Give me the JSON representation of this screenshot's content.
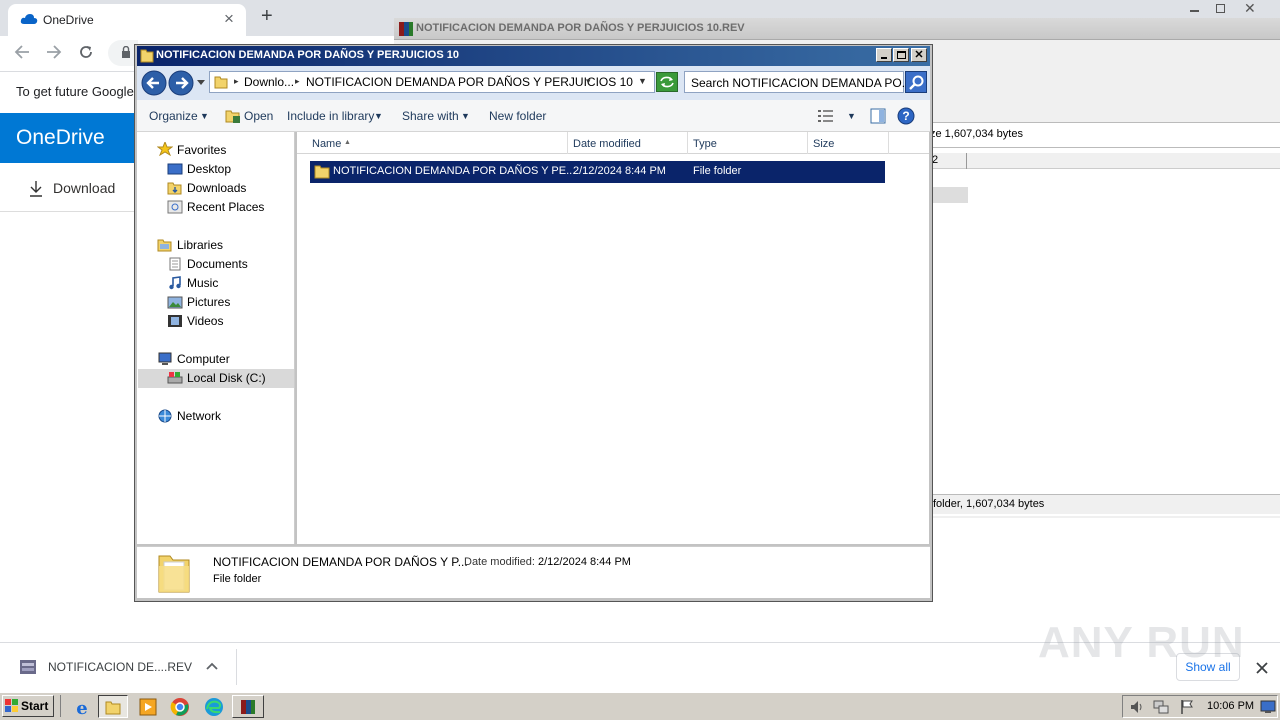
{
  "chrome": {
    "tab_title": "OneDrive",
    "new_tab_symbol": "+",
    "close_symbol": "×",
    "infobar_text": "To get future Google",
    "onedrive_brand": "OneDrive",
    "download_label": "Download",
    "download_bar_file": "NOTIFICACION DE....REV",
    "show_all_label": "Show all",
    "icons": [
      "onedrive-cloud-icon",
      "back-icon",
      "forward-icon",
      "reload-icon",
      "lock-icon",
      "download-arrow-icon",
      "file-icon",
      "chevron-up-icon",
      "close-icon"
    ]
  },
  "rar": {
    "title": "NOTIFICACION DEMANDA POR DAÑOS Y PERJUICIOS 10.REV",
    "size_text": "ze 1,607,034 bytes",
    "col_fragment": "2",
    "status_text": "folder, 1,607,034 bytes"
  },
  "explorer": {
    "title": "NOTIFICACION DEMANDA POR DAÑOS Y PERJUICIOS 10",
    "breadcrumb": {
      "part1": "Downlo...",
      "part2": "NOTIFICACION DEMANDA POR DAÑOS Y PERJUICIOS 10"
    },
    "search_placeholder": "Search NOTIFICACION DEMANDA PO...",
    "toolbar": {
      "organize": "Organize",
      "open": "Open",
      "include_library": "Include in library",
      "share_with": "Share with",
      "new_folder": "New folder"
    },
    "nav": {
      "favorites": "Favorites",
      "desktop": "Desktop",
      "downloads": "Downloads",
      "recent_places": "Recent Places",
      "libraries": "Libraries",
      "documents": "Documents",
      "music": "Music",
      "pictures": "Pictures",
      "videos": "Videos",
      "computer": "Computer",
      "local_disk": "Local Disk (C:)",
      "network": "Network"
    },
    "columns": {
      "name": "Name",
      "date_modified": "Date modified",
      "type": "Type",
      "size": "Size"
    },
    "rows": [
      {
        "name": "NOTIFICACION DEMANDA POR DAÑOS Y PE...",
        "date": "2/12/2024 8:44 PM",
        "type": "File folder",
        "size": ""
      }
    ],
    "details": {
      "name": "NOTIFICACION DEMANDA POR DAÑOS Y P...",
      "date_label": "Date modified:",
      "date_value": "2/12/2024 8:44 PM",
      "type": "File folder"
    }
  },
  "taskbar": {
    "start_label": "Start",
    "clock": "10:06 PM"
  },
  "watermark": "ANY RUN",
  "colors": {
    "onedrive_blue": "#0078d4",
    "selection_blue": "#0a246a",
    "xp_title_start": "#0a246a",
    "xp_title_end": "#3a6ea5",
    "taskbar_gray": "#d4d0c8"
  }
}
